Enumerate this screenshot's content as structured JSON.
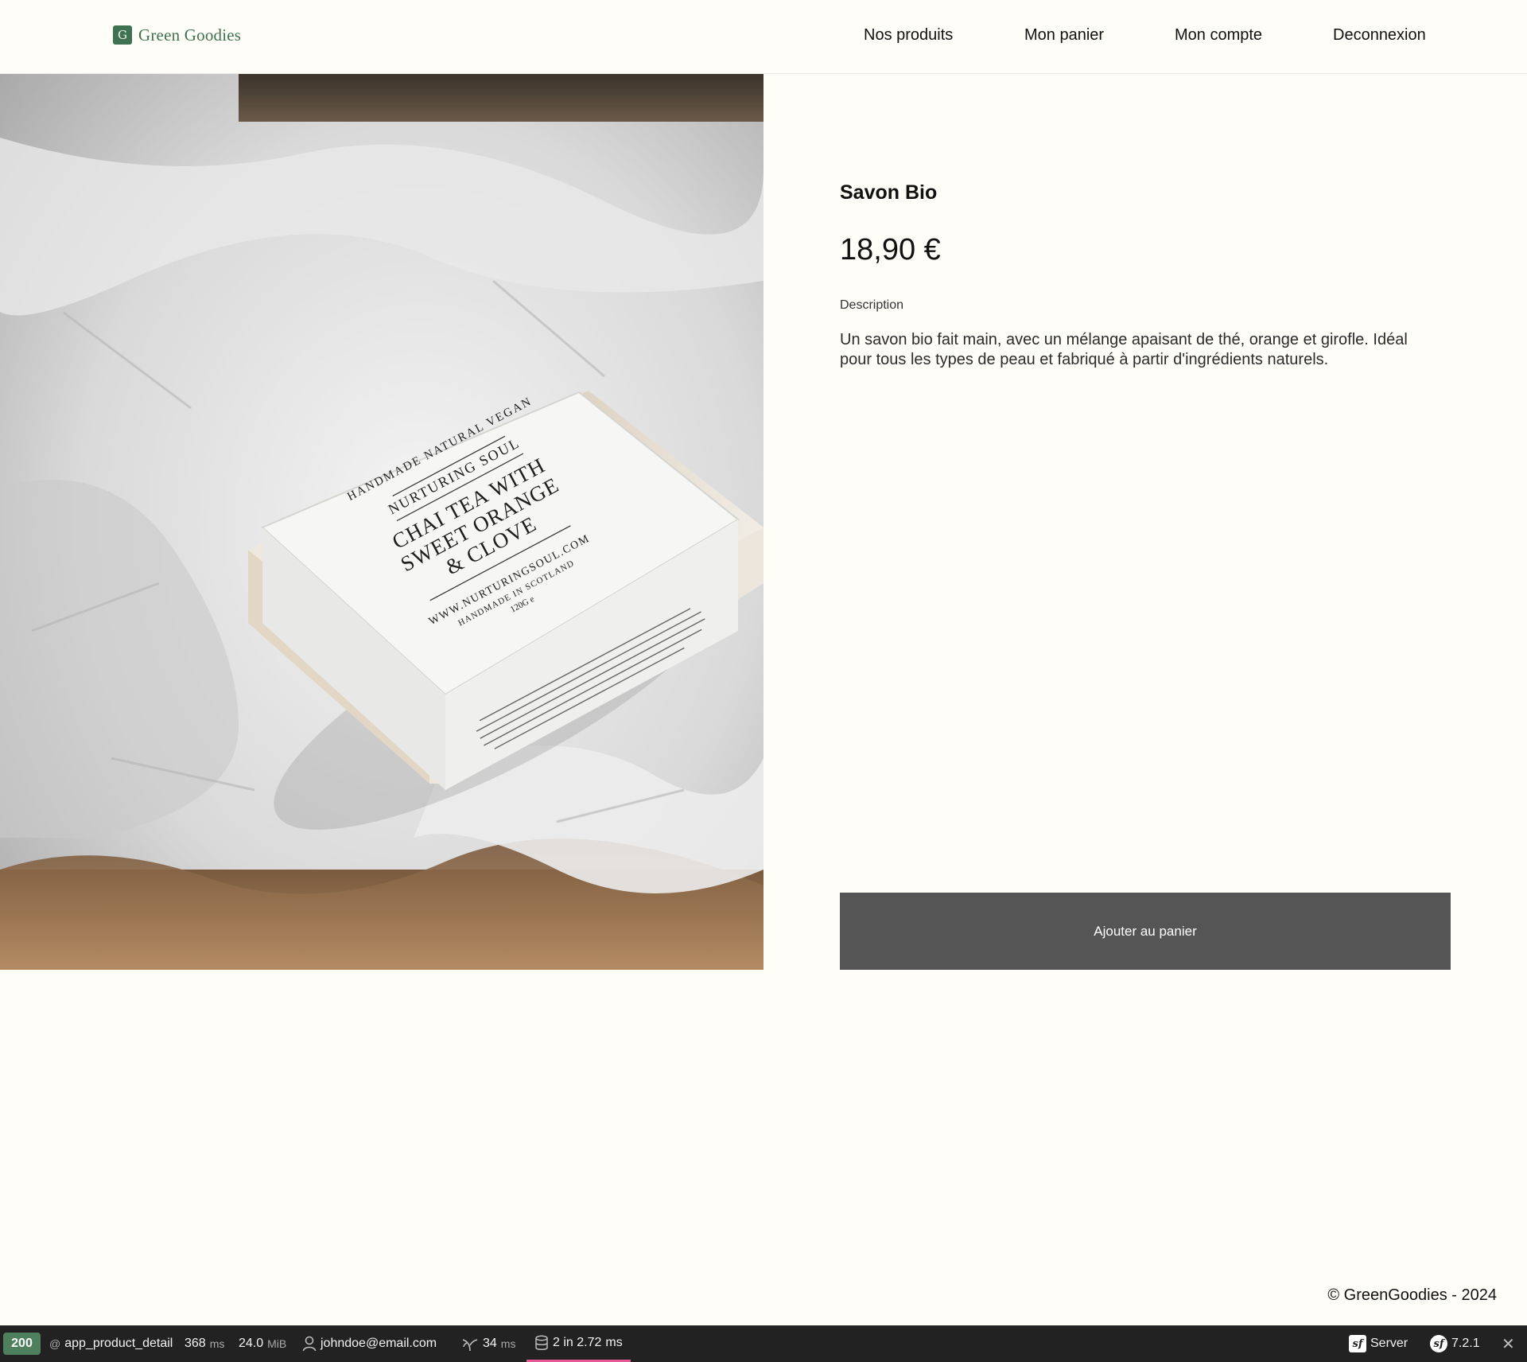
{
  "header": {
    "logo_mark": "G",
    "logo_text": "Green Goodies",
    "nav": [
      "Nos produits",
      "Mon panier",
      "Mon compte",
      "Deconnexion"
    ]
  },
  "product": {
    "image_label": {
      "line1": "HANDMADE NATURAL VEGAN",
      "line2": "NURTURING SOUL",
      "line3": "CHAI TEA WITH",
      "line4": "SWEET ORANGE",
      "line5": "& CLOVE",
      "line6": "WWW.NURTURINGSOUL.COM",
      "line7": "HANDMADE IN SCOTLAND",
      "line8": "120G e"
    },
    "title": "Savon Bio",
    "price": "18,90 €",
    "description_label": "Description",
    "description": "Un savon bio fait main, avec un mélange apaisant de thé, orange et girofle. Idéal pour tous les types de peau et fabriqué à partir d'ingrédients naturels.",
    "add_to_cart": "Ajouter au panier"
  },
  "footer": {
    "copyright": "© GreenGoodies - 2024"
  },
  "toolbar": {
    "status": "200",
    "route_prefix": "@",
    "route": "app_product_detail",
    "time_value": "368",
    "time_unit": "ms",
    "memory_value": "24.0",
    "memory_unit": "MiB",
    "user": "johndoe@email.com",
    "twig_value": "34",
    "twig_unit": "ms",
    "db_value": "2 in 2.72",
    "db_unit": "ms",
    "server": "Server",
    "version": "7.2.1",
    "close": "✕"
  },
  "colors": {
    "background": "#fefdf8",
    "brand_green": "#3f7350",
    "button": "#555555",
    "toolbar": "#222222",
    "status_ok": "#4f805d",
    "db_accent": "#e55a95"
  }
}
